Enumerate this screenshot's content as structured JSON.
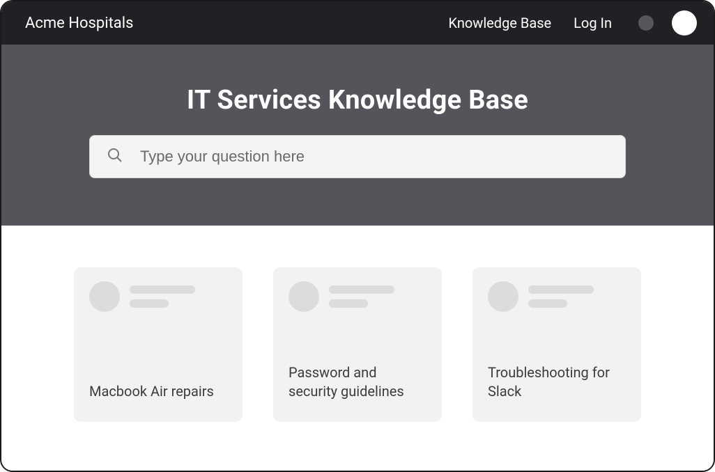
{
  "header": {
    "brand": "Acme Hospitals",
    "nav_kb": "Knowledge Base",
    "nav_login": "Log In"
  },
  "hero": {
    "title": "IT Services Knowledge Base",
    "search_placeholder": "Type your question here"
  },
  "cards": [
    {
      "title": "Macbook Air repairs"
    },
    {
      "title": "Password and security guidelines"
    },
    {
      "title": "Troubleshooting for Slack"
    }
  ]
}
